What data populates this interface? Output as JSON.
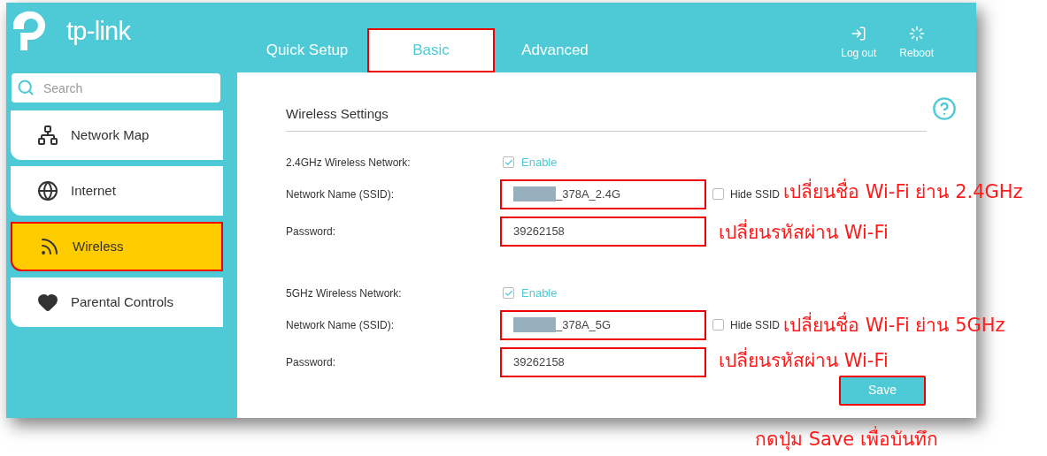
{
  "logo": {
    "text": "tp-link"
  },
  "tabs": [
    {
      "label": "Quick Setup",
      "selected": false,
      "highlighted": false
    },
    {
      "label": "Basic",
      "selected": true,
      "highlighted": true
    },
    {
      "label": "Advanced",
      "selected": false,
      "highlighted": false
    }
  ],
  "header_buttons": [
    {
      "kind": "logout",
      "label": "Log out"
    },
    {
      "kind": "reboot",
      "label": "Reboot"
    }
  ],
  "search": {
    "placeholder": "Search"
  },
  "sidebar": {
    "items": [
      {
        "kind": "network-map",
        "label": "Network Map",
        "selected": false,
        "highlighted": false
      },
      {
        "kind": "internet",
        "label": "Internet",
        "selected": false,
        "highlighted": false
      },
      {
        "kind": "wireless",
        "label": "Wireless",
        "selected": true,
        "highlighted": true
      },
      {
        "kind": "parental",
        "label": "Parental Controls",
        "selected": false,
        "highlighted": false
      }
    ]
  },
  "panel": {
    "title": "Wireless Settings",
    "sections": [
      {
        "label": "2.4GHz Wireless Network:",
        "enable": {
          "label": "Enable",
          "checked": true
        },
        "fields": [
          {
            "label": "Network Name (SSID):",
            "value": "_378A_2.4G",
            "redacted": true,
            "highlighted": true,
            "hide": {
              "label": "Hide SSID",
              "checked": false
            }
          },
          {
            "label": "Password:",
            "value": "39262158",
            "highlighted": true
          }
        ]
      },
      {
        "label": "5GHz Wireless Network:",
        "enable": {
          "label": "Enable",
          "checked": true
        },
        "fields": [
          {
            "label": "Network Name (SSID):",
            "value": "_378A_5G",
            "redacted": true,
            "highlighted": true,
            "hide": {
              "label": "Hide SSID",
              "checked": false
            }
          },
          {
            "label": "Password:",
            "value": "39262158",
            "highlighted": true
          }
        ]
      }
    ]
  },
  "save_button": {
    "label": "Save",
    "highlighted": true
  },
  "annotations": [
    "เปลี่ยนชื่อ Wi-Fi ย่าน 2.4GHz",
    "เปลี่ยนรหัสผ่าน Wi-Fi",
    "เปลี่ยนชื่อ Wi-Fi ย่าน 5GHz",
    "เปลี่ยนรหัสผ่าน Wi-Fi",
    "กดปุ่ม Save เพื่อบันทึก"
  ]
}
